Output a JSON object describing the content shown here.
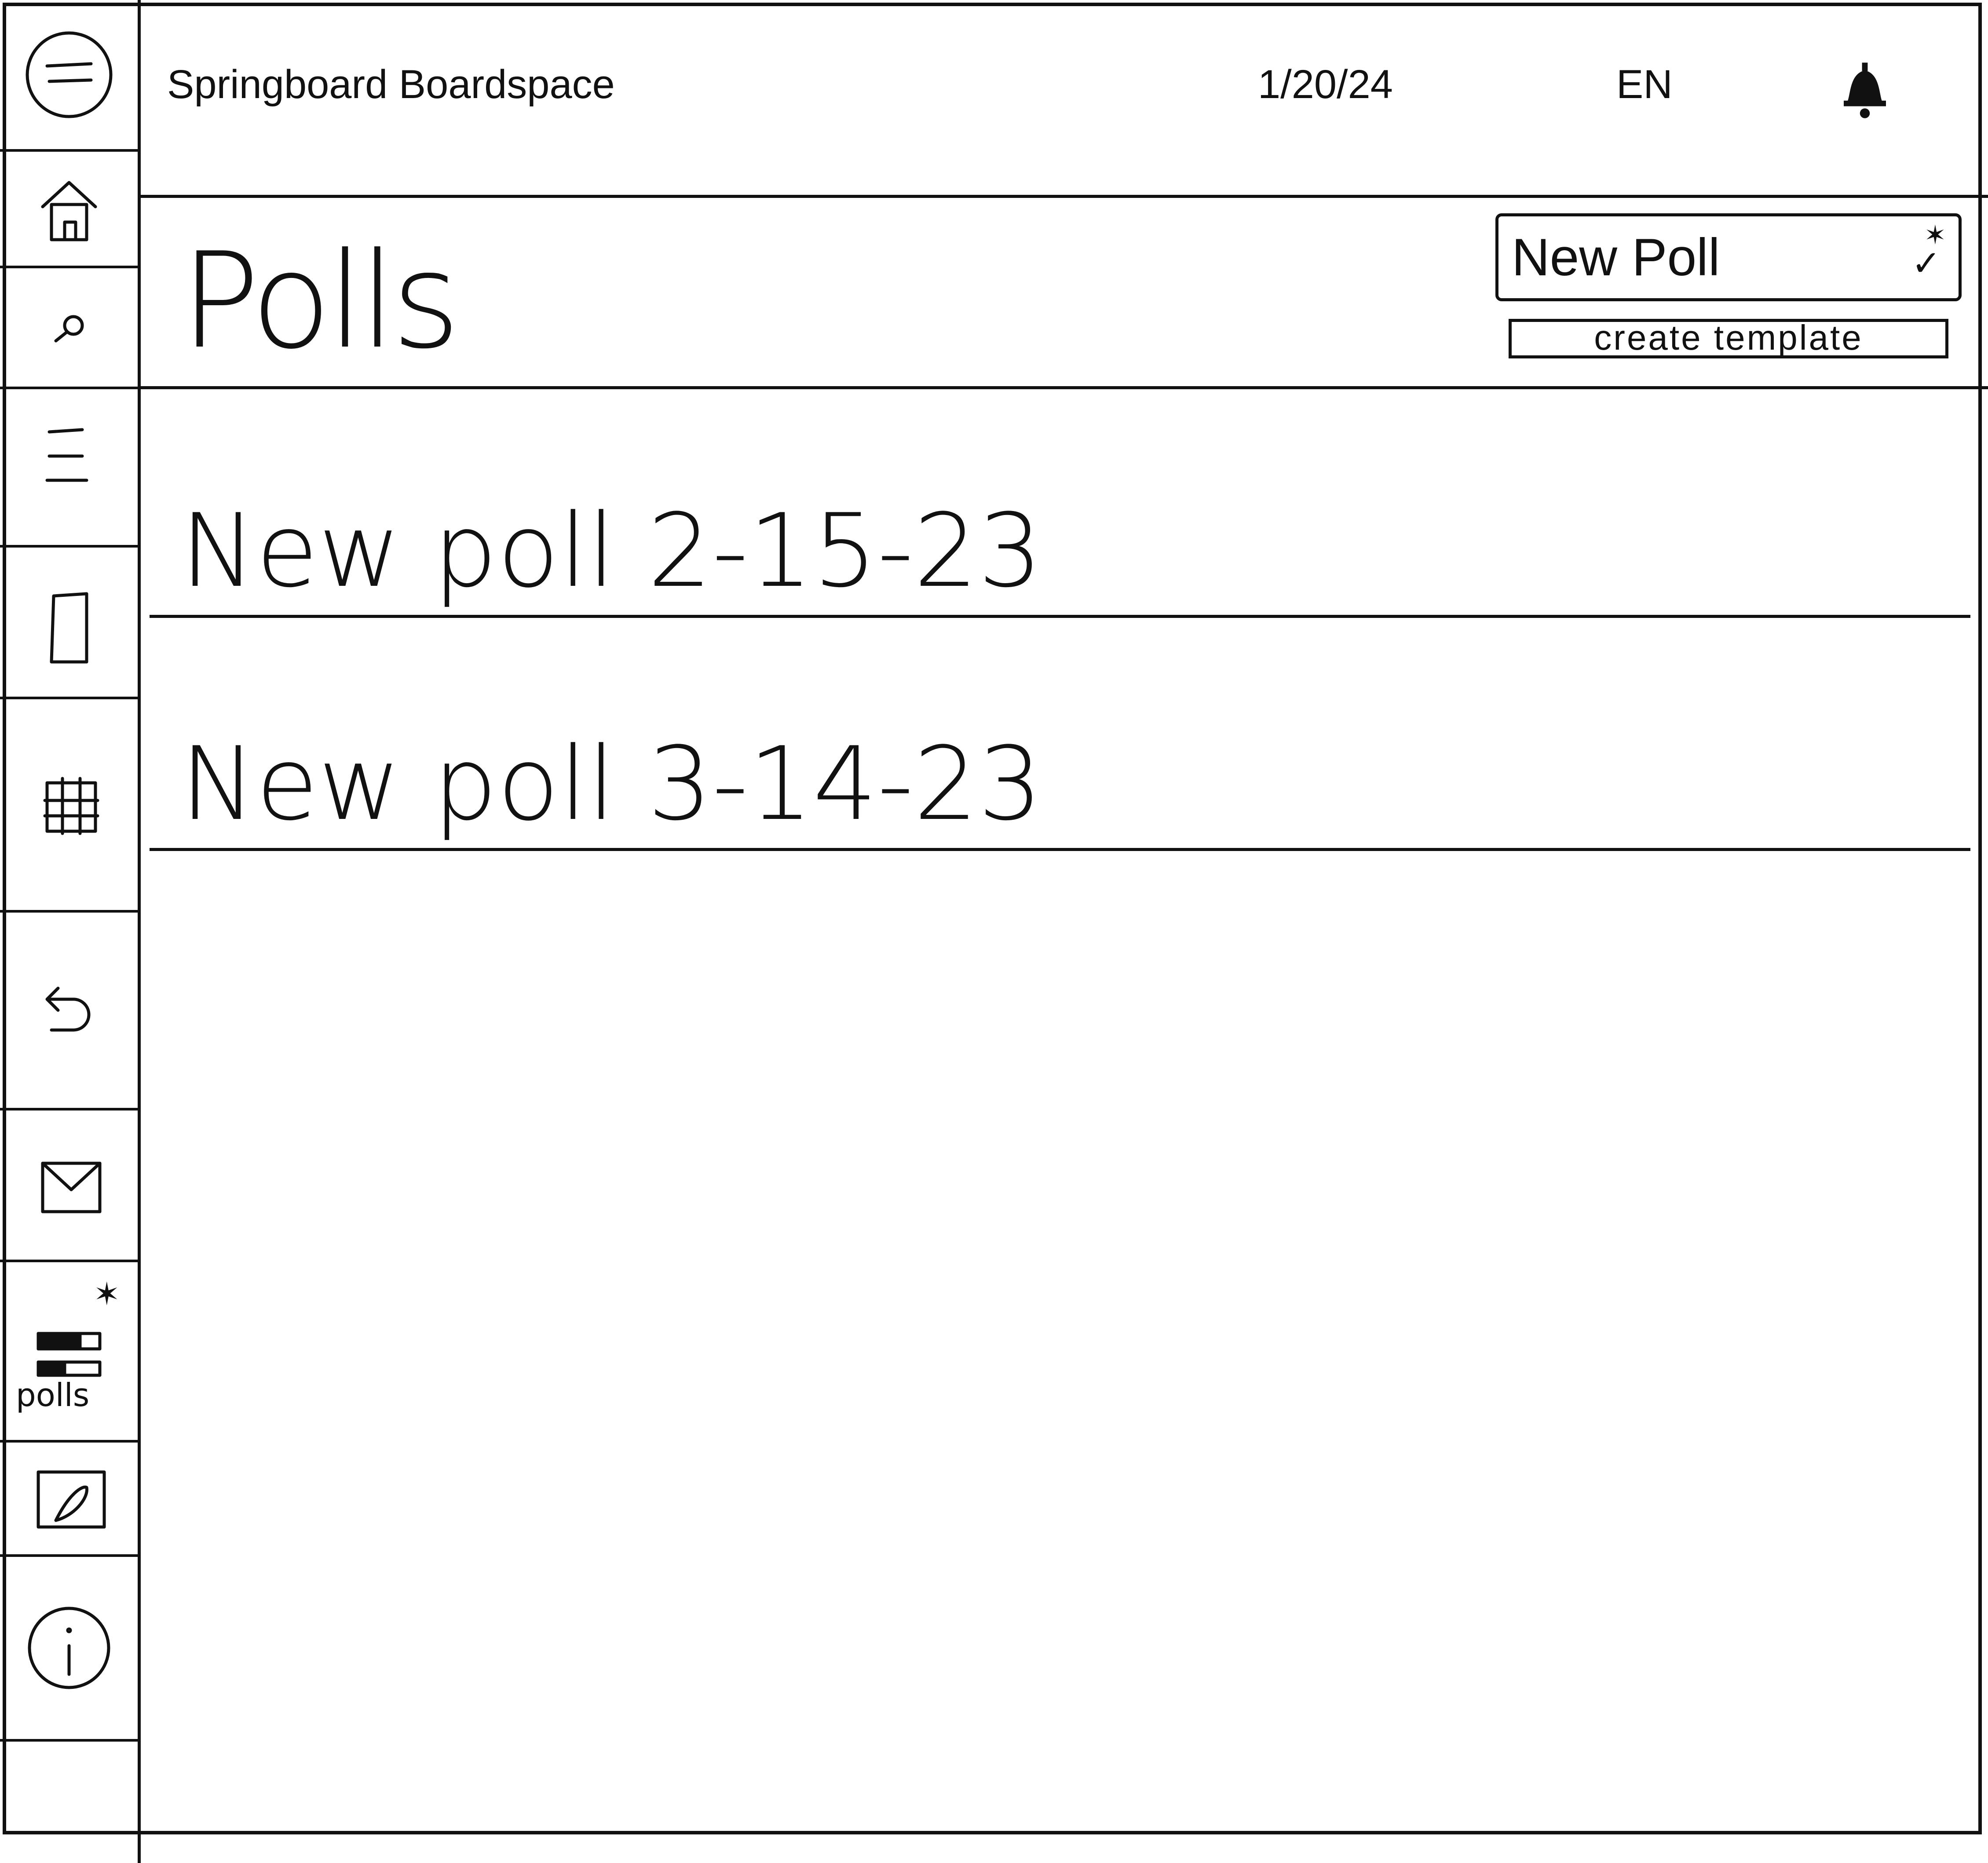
{
  "topbar": {
    "app_title": "Springboard Boardspace",
    "date": "1/20/24",
    "language": "EN",
    "bell_icon": "bell-icon"
  },
  "sidebar": {
    "items": [
      {
        "icon": "menu-icon"
      },
      {
        "icon": "home-icon"
      },
      {
        "icon": "search-icon"
      },
      {
        "icon": "list-icon"
      },
      {
        "icon": "document-icon"
      },
      {
        "icon": "grid-icon"
      },
      {
        "icon": "undo-icon"
      },
      {
        "icon": "mail-icon"
      },
      {
        "icon": "polls-icon",
        "label": "polls",
        "active": true
      },
      {
        "icon": "edit-icon"
      },
      {
        "icon": "info-icon"
      }
    ]
  },
  "page": {
    "title": "Polls",
    "new_poll_select": "New Poll",
    "create_template": "create template"
  },
  "polls": [
    {
      "name": "New poll 2-15-23"
    },
    {
      "name": "New poll 3-14-23"
    }
  ]
}
